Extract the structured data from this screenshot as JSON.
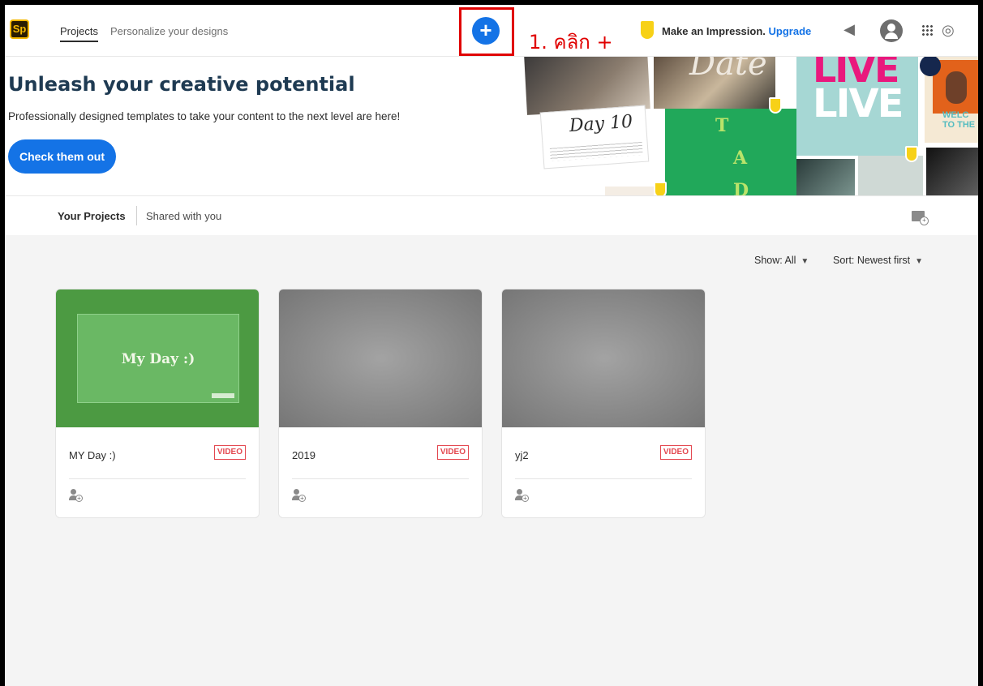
{
  "app": {
    "logo": "Sp"
  },
  "nav": {
    "tabs": [
      {
        "label": "Projects",
        "active": true
      },
      {
        "label": "Personalize your designs",
        "active": false
      }
    ]
  },
  "toolbar": {
    "create_button": "+",
    "annotation": "1. คลิก +",
    "premium_text": "Make an Impression.",
    "upgrade_label": "Upgrade",
    "icons": [
      "megaphone-icon",
      "avatar-icon",
      "apps-grid-icon",
      "creative-cloud-icon"
    ],
    "accent_color": "#1473e6",
    "highlight_color": "#e00000"
  },
  "hero": {
    "title": "Unleash your creative potential",
    "subtitle": "Professionally designed templates to take your content to the next level are here!",
    "cta_label": "Check them out",
    "art": {
      "day_text": "Day 10",
      "script_text": "Date",
      "live_word": "LIVE",
      "welcome_text": "WELC TO THE",
      "letters": [
        "T",
        "A",
        "D"
      ]
    }
  },
  "project_tabs": [
    {
      "label": "Your Projects",
      "active": true
    },
    {
      "label": "Shared with you",
      "active": false
    }
  ],
  "filters": {
    "show_label": "Show: All",
    "sort_label": "Sort: Newest first"
  },
  "projects": [
    {
      "name": "MY Day :)",
      "type": "VIDEO",
      "thumb_title": "My Day :)"
    },
    {
      "name": "2019",
      "type": "VIDEO",
      "thumb_title": ""
    },
    {
      "name": "yj2",
      "type": "VIDEO",
      "thumb_title": ""
    }
  ]
}
